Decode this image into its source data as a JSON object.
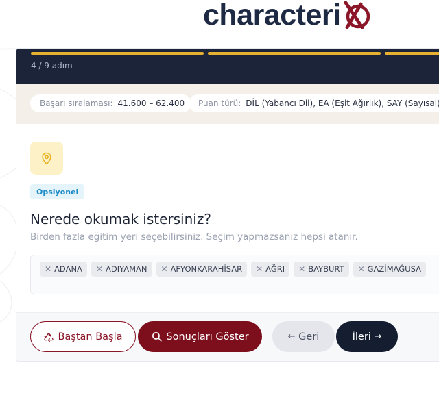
{
  "brand": {
    "name": "characteri",
    "logo_color": "#1e2a44",
    "x_color": "#8a1628"
  },
  "progress": {
    "step_text": "4 / 9 adım",
    "current_step": 4,
    "total_steps": 9,
    "bar_color": "#e6b130"
  },
  "filters": [
    {
      "label": "Başarı sıralaması:",
      "value": "41.600 – 62.400"
    },
    {
      "label": "Puan türü:",
      "value": "DİL (Yabancı Dil), EA (Eşit Ağırlık), SAY (Sayısal), S"
    }
  ],
  "question": {
    "icon": "location-pin-icon",
    "badge": "Opsiyonel",
    "title": "Nerede okumak istersiniz?",
    "hint": "Birden fazla eğitim yeri seçebilirsiniz. Seçim yapmazsanız hepsi atanır.",
    "selected": [
      "ADANA",
      "ADIYAMAN",
      "AFYONKARAHİSAR",
      "AĞRI",
      "BAYBURT",
      "GAZİMAĞUSA"
    ]
  },
  "actions": {
    "restart": "Baştan Başla",
    "results": "Sonuçları Göster",
    "back": "Geri",
    "next": "İleri",
    "back_arrow": "←",
    "next_arrow": "→"
  },
  "colors": {
    "accent": "#7d0f1d",
    "dark": "#151d30",
    "badge": "#1e8bc6"
  }
}
